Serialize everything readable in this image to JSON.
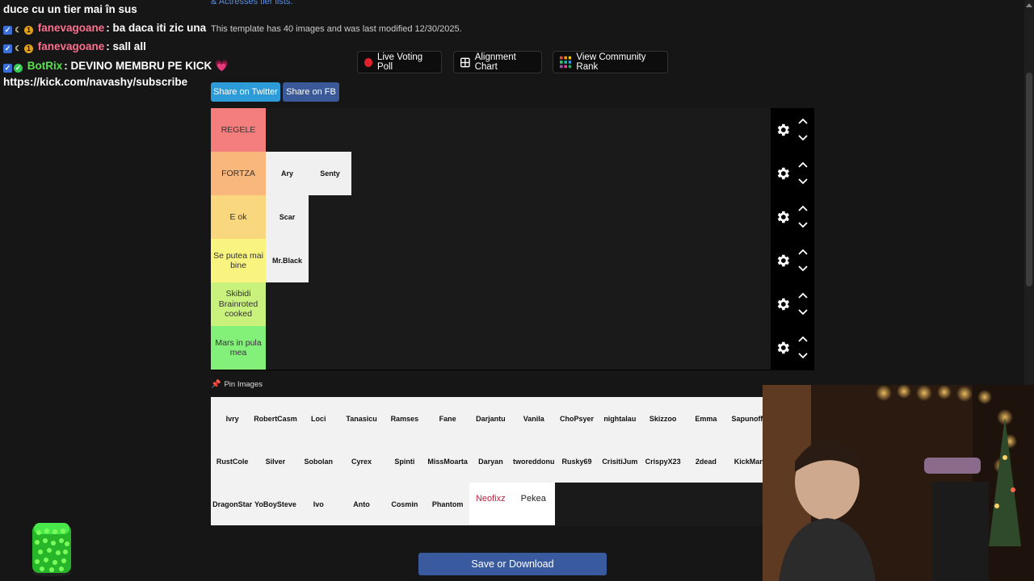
{
  "chat": {
    "lines": [
      {
        "user": "",
        "message": "duce cu un tier mai în sus"
      },
      {
        "user": "fanevagoane",
        "message": ": ba daca iti zic una"
      },
      {
        "user": "fanevagoane",
        "message": ": sall all"
      },
      {
        "user": "BotRix",
        "message": ": DEVINO MEMBRU PE KICK"
      },
      {
        "user": "",
        "message": "https://kick.com/navashy/subscribe"
      }
    ],
    "user_colors": {
      "fanevagoane": "#ff6f8e",
      "BotRix": "#56e04b"
    }
  },
  "page": {
    "top_link": "& Actresses tier lists.",
    "meta": "This template has 40 images and was last modified 12/30/2025.",
    "toolbar": {
      "live_voting": "Live Voting Poll",
      "alignment_chart": "Alignment Chart",
      "community_rank": "View Community Rank"
    },
    "share": {
      "twitter": "Share on Twitter",
      "fb": "Share on FB"
    },
    "tiers": [
      {
        "label": "REGELE",
        "color": "#f47d7d",
        "items": []
      },
      {
        "label": "FORTZA",
        "color": "#f9b77c",
        "items": [
          "Ary",
          "Senty"
        ]
      },
      {
        "label": "E ok",
        "color": "#f8d77f",
        "items": [
          "Scar"
        ]
      },
      {
        "label": "Se putea mai bine",
        "color": "#f9f37f",
        "items": [
          "Mr.Black"
        ]
      },
      {
        "label": "Skibidi Brainroted cooked",
        "color": "#c8f27c",
        "items": []
      },
      {
        "label": "Mars in pula mea",
        "color": "#83f07a",
        "items": []
      }
    ],
    "pin_images": "Pin Images",
    "pool_rows": [
      [
        "Ivry",
        "RobertCasm",
        "Loci",
        "Tanasicu",
        "Ramses",
        "Fane",
        "Darjantu",
        "Vanila",
        "ChoPsyer",
        "nightalau",
        "Skizzoo",
        "Emma",
        "SapunofM"
      ],
      [
        "RustCole",
        "Silver",
        "Sobolan",
        "Cyrex",
        "Spinti",
        "MissMoarta",
        "Daryan",
        "tworeddonu",
        "Rusky69",
        "CrisitiJum",
        "CrispyX23",
        "2dead",
        "KickMan"
      ],
      [
        "DragonStar",
        "YoBoySteve",
        "Ivo",
        "Anto",
        "Cosmin",
        "Phantom"
      ]
    ],
    "pool_extra": [
      {
        "label": "Neofixz",
        "color": "#c0203f"
      },
      {
        "label": "Pekea",
        "color": "#222222"
      }
    ],
    "save": "Save or Download"
  }
}
